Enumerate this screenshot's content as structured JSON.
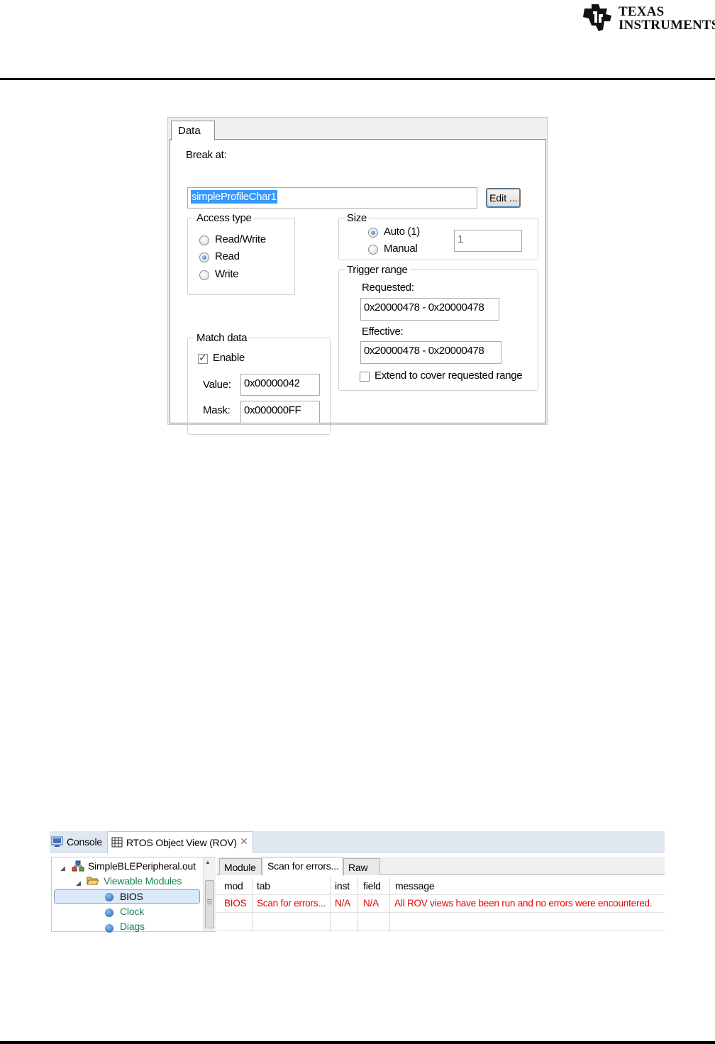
{
  "header": {
    "logo_line1": "TEXAS",
    "logo_line2": "INSTRUMENTS"
  },
  "breakpoint_dialog": {
    "tab_label": "Data",
    "break_at_label": "Break at:",
    "break_at_value": "simpleProfileChar1",
    "edit_button_label": "Edit ...",
    "access_type": {
      "legend": "Access type",
      "options": [
        "Read/Write",
        "Read",
        "Write"
      ],
      "selected": "Read"
    },
    "size": {
      "legend": "Size",
      "auto_label": "Auto (1)",
      "manual_label": "Manual",
      "selected": "Auto (1)",
      "value": "1"
    },
    "trigger_range": {
      "legend": "Trigger range",
      "requested_label": "Requested:",
      "requested_value": "0x20000478 - 0x20000478",
      "effective_label": "Effective:",
      "effective_value": "0x20000478 - 0x20000478",
      "extend_label": "Extend to cover requested range",
      "extend_checked": false
    },
    "match_data": {
      "legend": "Match data",
      "enable_label": "Enable",
      "enable_checked": true,
      "value_label": "Value:",
      "value": "0x00000042",
      "mask_label": "Mask:",
      "mask": "0x000000FF"
    }
  },
  "rov_view": {
    "tabs": {
      "console": "Console",
      "rov": "RTOS Object View (ROV)"
    },
    "tree": {
      "root": "SimpleBLEPeripheral.out",
      "group": "Viewable Modules",
      "items": [
        "BIOS",
        "Clock",
        "Diags"
      ],
      "selected": "BIOS"
    },
    "subtabs": [
      "Module",
      "Scan for errors...",
      "Raw"
    ],
    "active_subtab": "Scan for errors...",
    "table": {
      "columns": [
        "mod",
        "tab",
        "inst",
        "field",
        "message"
      ],
      "rows": [
        [
          "BIOS",
          "Scan for errors...",
          "N/A",
          "N/A",
          "All ROV views have been run and no errors were encountered."
        ]
      ]
    },
    "colors": {
      "error_text": "#e60000",
      "tree_item_text": "#1a7f5a",
      "tab_bar": "#dfe8f1"
    }
  }
}
